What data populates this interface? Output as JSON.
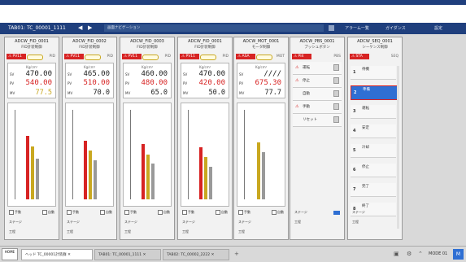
{
  "nav": {
    "title": "TAB01: TC_00001_1111",
    "crumb": "画面ナビゲーション",
    "item1": "アラーム一覧",
    "item2": "ガイダンス",
    "item3": "設定"
  },
  "panels": [
    {
      "title": "ADCW_FID_0001",
      "sub": "FID計装制御",
      "status": "PV11",
      "right": "PID",
      "unit": "Kg/cm²",
      "sv_label": "SV",
      "sv": "470.00",
      "pv_label": "PV",
      "pv": "540.00",
      "mv_label": "MV",
      "mv": "77.5",
      "mode": "手動",
      "mode2": "自動",
      "c1": "ステージ",
      "c2": "工程"
    },
    {
      "title": "ADCW_FID_0002",
      "sub": "FID計装制御",
      "status": "PV11",
      "right": "PID",
      "unit": "Kg/cm²",
      "sv_label": "SV",
      "sv": "465.00",
      "pv_label": "PV",
      "pv": "510.00",
      "mv_label": "MV",
      "mv": "70.0",
      "mode": "手動",
      "mode2": "自動",
      "c1": "ステージ",
      "c2": "工程"
    },
    {
      "title": "ADCW_FID_0003",
      "sub": "FID計装制御",
      "status": "PV11",
      "right": "PID",
      "unit": "Kg/cm²",
      "sv_label": "SV",
      "sv": "460.00",
      "pv_label": "PV",
      "pv": "480.00",
      "mv_label": "MV",
      "mv": "65.0",
      "mode": "手動",
      "mode2": "自動",
      "c1": "ステージ",
      "c2": "工程"
    },
    {
      "title": "ADCW_FID_0001",
      "sub": "FID計装制御",
      "status": "PV11",
      "right": "PID",
      "unit": "Kg/cm²",
      "sv_label": "SV",
      "sv": "470.00",
      "pv_label": "PV",
      "pv": "420.00",
      "mv_label": "MV",
      "mv": "50.0",
      "mode": "手動",
      "mode2": "自動",
      "c1": "ステージ",
      "c2": "工程"
    },
    {
      "title": "ADCW_MOT_0001",
      "sub": "モータ制御",
      "status": "ASA",
      "right": "MOT",
      "unit": "Kg/cm²",
      "sv_label": "SV",
      "sv": "////",
      "pv_label": "PV",
      "pv": "675.30",
      "mv_label": "MV",
      "mv": "77.7",
      "mode": "手動",
      "mode2": "自動",
      "c1": "ステージ",
      "c2": "工程"
    }
  ],
  "panel6": {
    "title": "ADCW_PBS_0001",
    "sub": "プッシュボタン",
    "status": "PI4",
    "right": "PBS",
    "rows": [
      "運転",
      "停止",
      "自動",
      "手動",
      "リセット"
    ],
    "c1": "ステージ",
    "c2": "工程"
  },
  "panel7": {
    "title": "ADCW_SEQ_0001",
    "sub": "シーケンス制御",
    "status": "STA",
    "right": "SEQ",
    "rows": [
      {
        "n": "1",
        "t": "待機"
      },
      {
        "n": "2",
        "t": "準備"
      },
      {
        "n": "3",
        "t": "運転"
      },
      {
        "n": "4",
        "t": "安定"
      },
      {
        "n": "5",
        "t": "冷却"
      },
      {
        "n": "6",
        "t": "停止"
      },
      {
        "n": "7",
        "t": "完了"
      },
      {
        "n": "8",
        "t": "終了"
      }
    ],
    "c1": "ステージ",
    "c2": "工程"
  },
  "tabs": [
    {
      "label": "ヘッド TC_00001計装群"
    },
    {
      "label": "TAB01: TC_00001_1111"
    },
    {
      "label": "TAB02: TC_00002_2222"
    }
  ],
  "home": {
    "label": "HOME"
  },
  "status": {
    "mode": "MODE 01",
    "btn": "M"
  }
}
